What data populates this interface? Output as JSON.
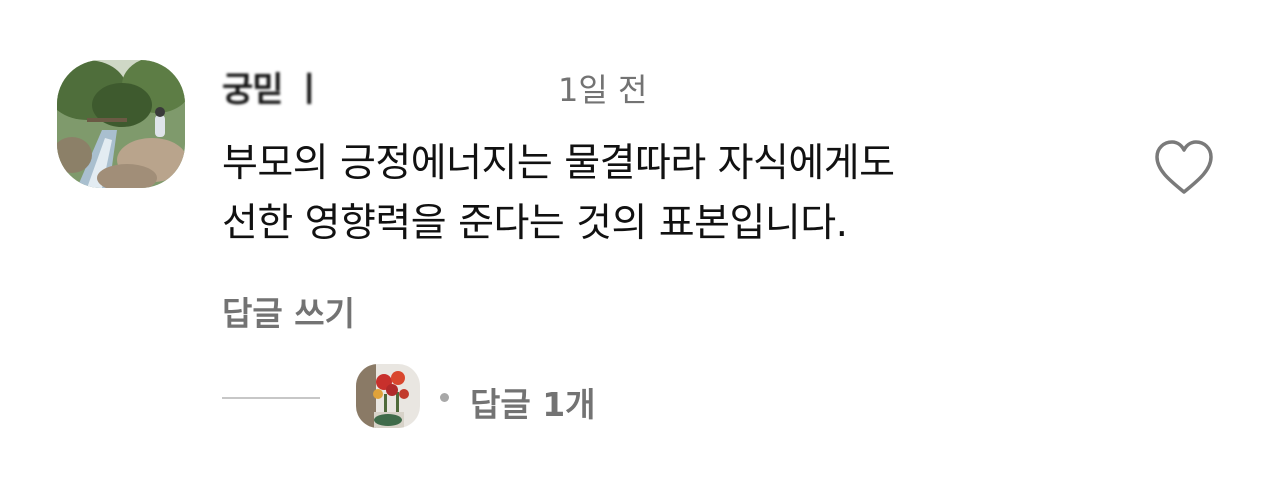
{
  "comment": {
    "username": "궁믿 ㅣ",
    "timestamp": "1일 전",
    "text_lines": [
      "부모의 긍정에너지는 물결따라 자식에게도",
      "선한 영향력을 준다는 것의 표본입니다."
    ],
    "reply_label": "답글 쓰기",
    "like_icon": "heart-outline-icon"
  },
  "replies": {
    "label": "답글 1개"
  },
  "colors": {
    "text": "#111111",
    "secondary": "#737373",
    "divider": "#c7c7c7"
  }
}
